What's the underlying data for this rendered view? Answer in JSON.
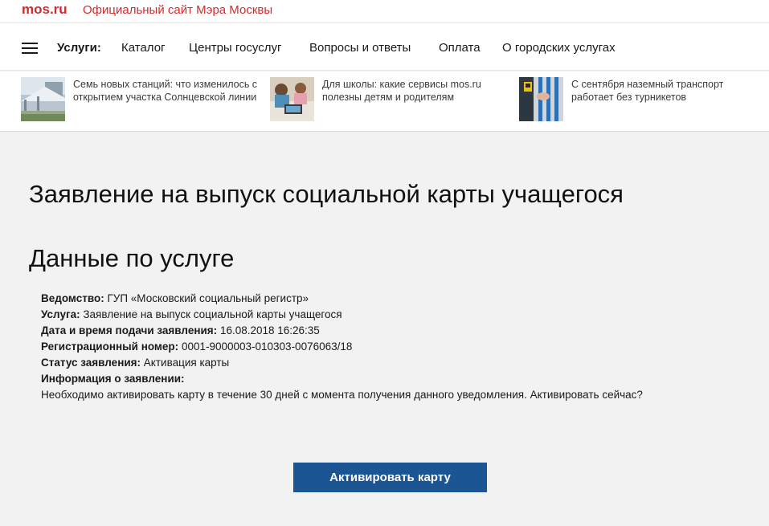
{
  "header": {
    "logo": "mos.ru",
    "site_title": "Официальный сайт Мэра Москвы"
  },
  "nav": {
    "label": "Услуги:",
    "items": [
      "Каталог",
      "Центры госуслуг",
      "Вопросы и ответы",
      "Оплата",
      "О городских услугах"
    ]
  },
  "news": [
    {
      "text": "Семь новых станций: что изменилось с открытием участка Солнцевской линии",
      "icon": "metro-station-photo"
    },
    {
      "text": "Для школы: какие сервисы mos.ru полезны детям и родителям",
      "icon": "school-children-photo"
    },
    {
      "text": "С сентября наземный транспорт работает без турникетов",
      "icon": "turnstile-photo"
    }
  ],
  "page": {
    "title": "Заявление на выпуск социальной карты учащегося",
    "section_title": "Данные по услуге"
  },
  "details": {
    "agency_label": "Ведомство:",
    "agency_value": "ГУП «Московский социальный регистр»",
    "service_label": "Услуга:",
    "service_value": "Заявление на выпуск социальной карты учащегося",
    "date_label": "Дата и время подачи заявления:",
    "date_value": "16.08.2018 16:26:35",
    "regnum_label": "Регистрационный номер:",
    "regnum_value": "0001-9000003-010303-0076063/18",
    "status_label": "Статус заявления:",
    "status_value": "Активация карты",
    "info_label": "Информация о заявлении:",
    "info_value": "Необходимо активировать карту в течение 30 дней с момента получения данного уведомления. Активировать сейчас?"
  },
  "action": {
    "button_label": "Активировать карту"
  },
  "colors": {
    "brand_red": "#cc2c2c",
    "button_blue": "#1c5593",
    "background": "#f2f2f2"
  }
}
